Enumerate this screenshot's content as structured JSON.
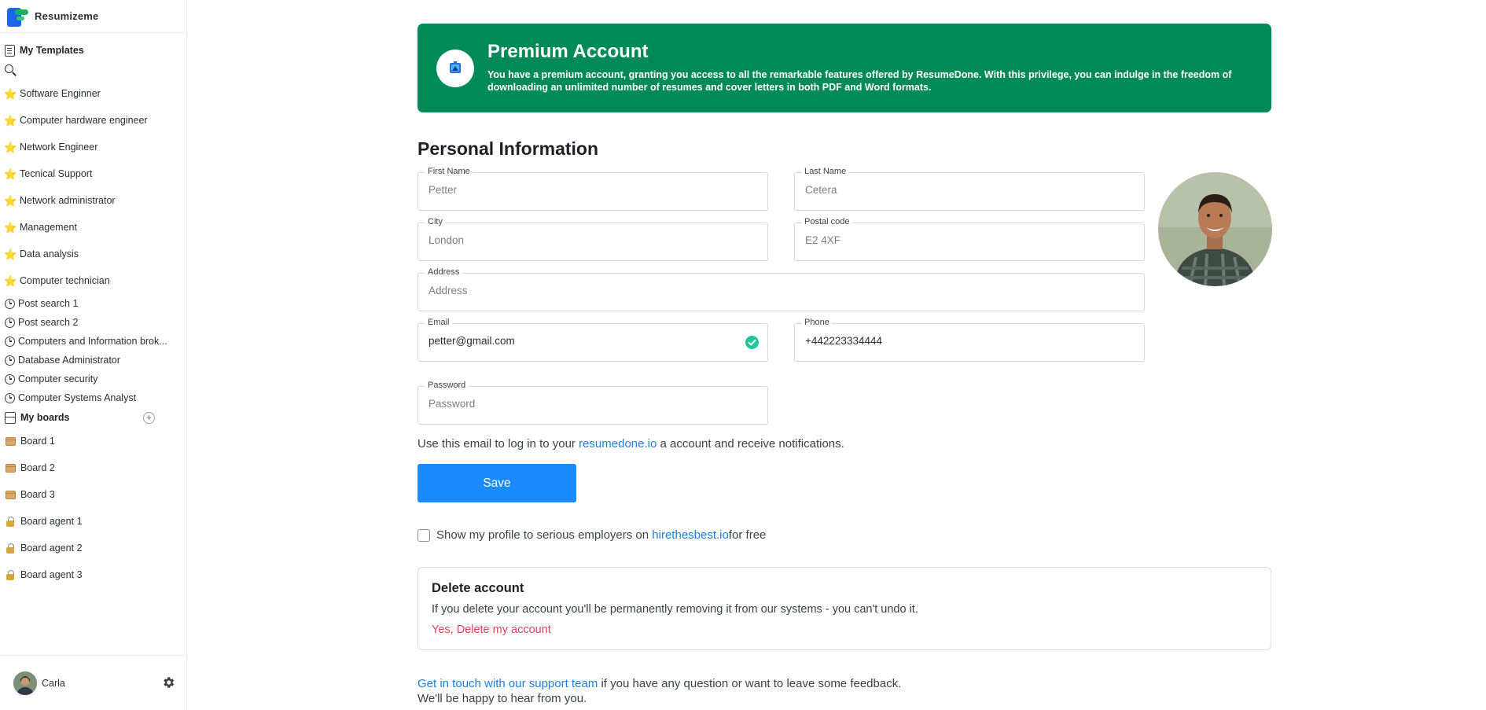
{
  "app": {
    "name": "Resumizeme"
  },
  "sidebar": {
    "templates_heading": "My Templates",
    "starred": [
      {
        "label": "Software Enginner"
      },
      {
        "label": "Computer hardware engineer"
      },
      {
        "label": "Network Engineer"
      },
      {
        "label": "Tecnical Support"
      },
      {
        "label": "Network administrator"
      },
      {
        "label": "Management"
      },
      {
        "label": "Data analysis"
      },
      {
        "label": "Computer technician"
      }
    ],
    "recent": [
      {
        "label": "Post search 1"
      },
      {
        "label": "Post search 2"
      },
      {
        "label": "Computers and Information brok..."
      },
      {
        "label": "Database Administrator"
      },
      {
        "label": "Computer security"
      },
      {
        "label": "Computer Systems Analyst"
      }
    ],
    "boards_heading": "My boards",
    "boards": [
      {
        "label": "Board 1",
        "icon": "box-icon"
      },
      {
        "label": "Board 2",
        "icon": "box-icon"
      },
      {
        "label": "Board 3",
        "icon": "box-icon"
      },
      {
        "label": "Board agent 1",
        "icon": "lock-icon"
      },
      {
        "label": "Board agent 2",
        "icon": "lock-icon"
      },
      {
        "label": "Board agent 3",
        "icon": "lock-icon"
      }
    ],
    "user": {
      "name": "Carla"
    }
  },
  "premium": {
    "title": "Premium Account",
    "description": "You have a premium account, granting you access to all the remarkable features offered by ResumeDone. With this privilege, you can indulge in the freedom of downloading an unlimited number of resumes and cover letters in both PDF and Word formats.",
    "color": "#008a58"
  },
  "personal_info": {
    "title": "Personal Information",
    "fields": {
      "first_name": {
        "label": "First Name",
        "value": "",
        "placeholder": "Petter"
      },
      "last_name": {
        "label": "Last Name",
        "value": "",
        "placeholder": "Cetera"
      },
      "city": {
        "label": "City",
        "value": "",
        "placeholder": "London"
      },
      "postal_code": {
        "label": "Postal code",
        "value": "",
        "placeholder": "E2 4XF"
      },
      "address": {
        "label": "Address",
        "value": "",
        "placeholder": "Address"
      },
      "email": {
        "label": "Email",
        "value": "petter@gmail.com",
        "placeholder": ""
      },
      "phone": {
        "label": "Phone",
        "value": "+442223334444",
        "placeholder": ""
      },
      "password": {
        "label": "Password",
        "value": "",
        "placeholder": "Password"
      }
    },
    "hint_prefix": "Use this email to log in to your ",
    "hint_link": "resumedone.io",
    "hint_suffix": " a account and receive notifications.",
    "save_label": "Save"
  },
  "employers": {
    "prefix": "Show my profile to serious employers on ",
    "link": "hirethesbest.io",
    "suffix": " for free",
    "checked": false
  },
  "delete_account": {
    "title": "Delete account",
    "description": "If you delete your account you'll be permanently removing it from our systems - you can't undo it.",
    "action": "Yes, Delete my account",
    "color": "#e0445a"
  },
  "support": {
    "link": "Get in touch with our support team",
    "text": " if you have any question or want to leave some feedback.",
    "line2": "We'll be happy to hear from you."
  },
  "accent_color": "#1a8cff"
}
